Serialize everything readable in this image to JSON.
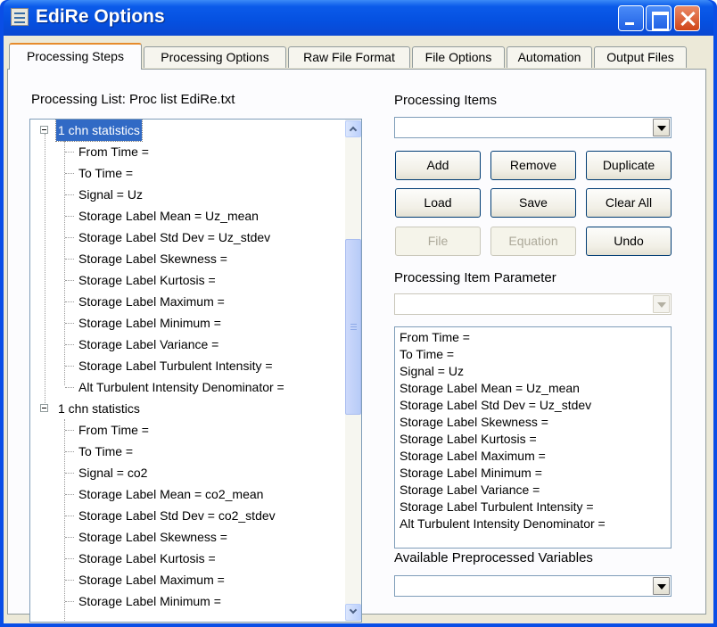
{
  "window": {
    "title": "EdiRe Options",
    "icon": "app-icon",
    "accent": "#0a4ee6"
  },
  "tabs": [
    {
      "label": "Processing Steps",
      "active": true
    },
    {
      "label": "Processing Options",
      "active": false
    },
    {
      "label": "Raw File Format",
      "active": false
    },
    {
      "label": "File Options",
      "active": false
    },
    {
      "label": "Automation",
      "active": false
    },
    {
      "label": "Output Files",
      "active": false
    }
  ],
  "processing_list": {
    "label": "Processing List: Proc list EdiRe.txt",
    "groups": [
      {
        "name": "1 chn statistics",
        "selected": true,
        "children": [
          "From Time =",
          "To Time =",
          "Signal = Uz",
          "Storage Label Mean = Uz_mean",
          "Storage Label Std Dev = Uz_stdev",
          "Storage Label Skewness =",
          "Storage Label Kurtosis =",
          "Storage Label Maximum =",
          "Storage Label Minimum =",
          "Storage Label Variance =",
          "Storage Label Turbulent Intensity =",
          "Alt Turbulent Intensity Denominator ="
        ]
      },
      {
        "name": "1 chn statistics",
        "selected": false,
        "children": [
          "From Time =",
          "To Time =",
          "Signal = co2",
          "Storage Label Mean =  co2_mean",
          "Storage Label Std Dev = co2_stdev",
          "Storage Label Skewness =",
          "Storage Label Kurtosis =",
          "Storage Label Maximum =",
          "Storage Label Minimum ="
        ]
      }
    ]
  },
  "processing_items": {
    "label": "Processing Items",
    "value": ""
  },
  "buttons": {
    "add": "Add",
    "remove": "Remove",
    "duplicate": "Duplicate",
    "load": "Load",
    "save": "Save",
    "clear_all": "Clear All",
    "file": "File",
    "equation": "Equation",
    "undo": "Undo"
  },
  "item_parameter": {
    "label": "Processing Item Parameter",
    "value": "",
    "lines": [
      "From Time =",
      "To Time =",
      "Signal = Uz",
      "Storage Label Mean = Uz_mean",
      "Storage Label Std Dev = Uz_stdev",
      "Storage Label Skewness =",
      "Storage Label Kurtosis =",
      "Storage Label Maximum =",
      "Storage Label Minimum =",
      "Storage Label Variance =",
      "Storage Label Turbulent Intensity =",
      "Alt Turbulent Intensity Denominator ="
    ]
  },
  "preprocessed": {
    "label": "Available Preprocessed Variables",
    "value": ""
  }
}
